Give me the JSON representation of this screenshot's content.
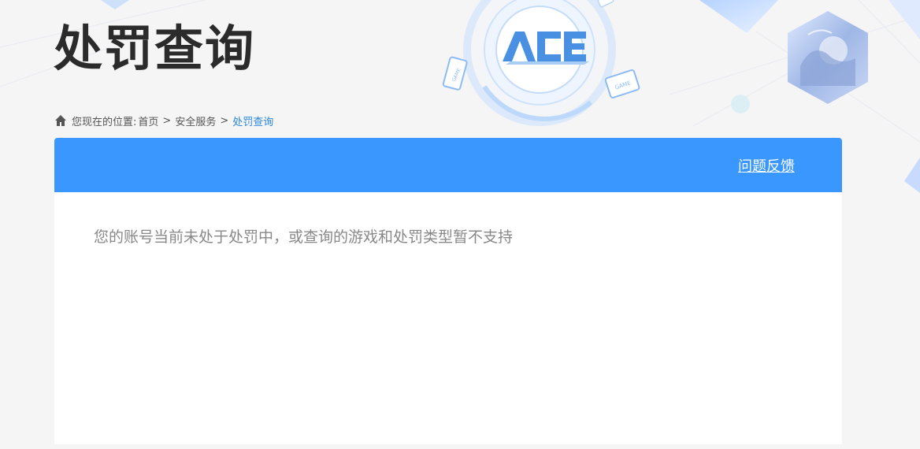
{
  "page": {
    "title": "处罚查询"
  },
  "breadcrumb": {
    "prefix": "您现在的位置:",
    "items": [
      {
        "label": "首页"
      },
      {
        "label": "安全服务"
      },
      {
        "label": "处罚查询"
      }
    ],
    "separator": ">"
  },
  "header": {
    "logo_text": "ACE",
    "badge_text": "GAME",
    "feedback_label": "问题反馈"
  },
  "content": {
    "message": "您的账号当前未处于处罚中，或查询的游戏和处罚类型暂不支持"
  },
  "colors": {
    "accent": "#3997fe",
    "breadcrumb_active": "#2a87d8",
    "title": "#2b2b2b",
    "message": "#888888"
  }
}
